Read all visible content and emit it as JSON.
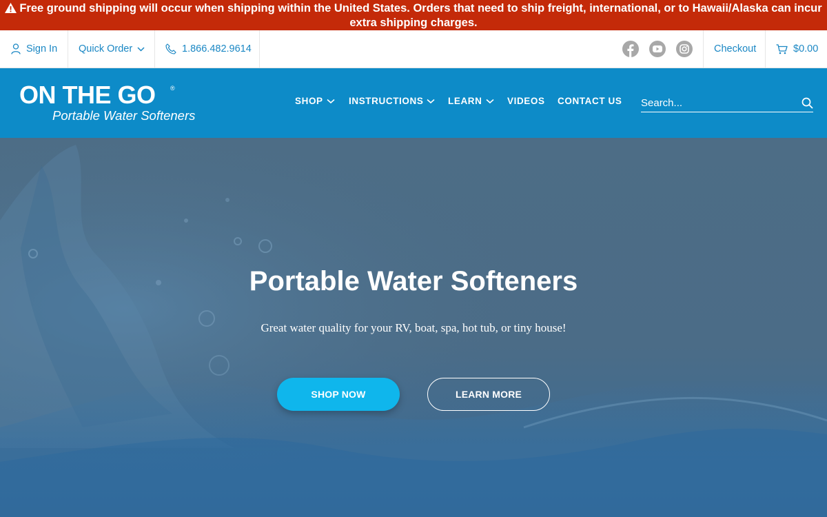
{
  "announcement": {
    "line1": "Free ground shipping will occur when shipping within the United States. Orders that need to ship freight, international, or to Hawaii/Alaska can incur",
    "line2": "extra shipping charges.",
    "icon": "warning-icon"
  },
  "utility": {
    "sign_in": "Sign In",
    "quick_order": "Quick Order",
    "phone": "1.866.482.9614",
    "checkout": "Checkout",
    "cart_total": "$0.00",
    "social": [
      "facebook-icon",
      "youtube-icon",
      "instagram-icon"
    ]
  },
  "logo": {
    "title": "ON THE GO",
    "registered": "®",
    "subtitle": "Portable Water Softeners"
  },
  "nav": {
    "shop": "SHOP",
    "instructions": "INSTRUCTIONS",
    "learn": "LEARN",
    "videos": "VIDEOS",
    "contact": "CONTACT US"
  },
  "search": {
    "placeholder": "Search..."
  },
  "hero": {
    "title": "Portable Water Softeners",
    "subtitle": "Great water quality for your RV, boat, spa, hot tub, or tiny house!",
    "primary_button": "SHOP NOW",
    "secondary_button": "LEARN MORE"
  },
  "colors": {
    "announcement_bg": "#c42a09",
    "utility_link": "#1a87c4",
    "nav_bg": "#0d8bc8",
    "hero_overlay": "#4b6c87",
    "shop_button": "#0fb6ec",
    "social_icon": "#a8a8a8"
  }
}
